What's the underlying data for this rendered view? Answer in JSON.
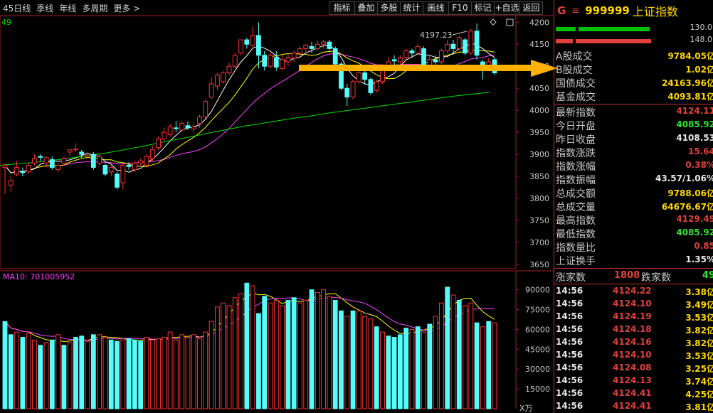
{
  "toolbar": {
    "left": [
      "45日线",
      "季线",
      "年线",
      "多周期",
      "更多 >"
    ],
    "right": [
      "指标",
      "叠加",
      "多股",
      "统计",
      "画线",
      "F10",
      "标记",
      "+自选",
      "返回"
    ]
  },
  "chart": {
    "ma_indicator_label": "49",
    "peak_label": "4197.23",
    "price_ticks": [
      "4200",
      "4150",
      "4100",
      "4050",
      "4000",
      "3950",
      "3900",
      "3850",
      "3800",
      "3750",
      "3700",
      "3650"
    ],
    "volume_indicator_label": "MA10: 701005952",
    "volume_ticks": [
      "90000",
      "75000",
      "60000",
      "45000",
      "30000",
      "15000"
    ],
    "volume_unit": "X万",
    "colors": {
      "up": "#ff3232",
      "down": "#54fcfc",
      "ma5": "#ffffff",
      "ma10": "#ffff00",
      "ma20": "#ff40ff",
      "ma60": "#00e000"
    }
  },
  "chart_data": {
    "type": "candlestick",
    "ylim": [
      3640,
      4215
    ],
    "candles": [
      [
        3870,
        3875,
        3810,
        3880
      ],
      [
        3830,
        3840,
        3815,
        3850
      ],
      [
        3855,
        3870,
        3850,
        3885
      ],
      [
        3860,
        3858,
        3850,
        3870
      ],
      [
        3860,
        3875,
        3855,
        3880
      ],
      [
        3880,
        3890,
        3875,
        3900
      ],
      [
        3895,
        3893,
        3885,
        3900
      ],
      [
        3880,
        3892,
        3870,
        3895
      ],
      [
        3888,
        3870,
        3865,
        3895
      ],
      [
        3865,
        3875,
        3860,
        3880
      ],
      [
        3880,
        3890,
        3875,
        3895
      ],
      [
        3905,
        3910,
        3895,
        3912
      ],
      [
        3910,
        3912,
        3905,
        3925
      ],
      [
        3905,
        3900,
        3890,
        3910
      ],
      [
        3895,
        3898,
        3890,
        3905
      ],
      [
        3900,
        3870,
        3865,
        3905
      ],
      [
        3880,
        3895,
        3875,
        3900
      ],
      [
        3875,
        3855,
        3850,
        3880
      ],
      [
        3860,
        3870,
        3850,
        3875
      ],
      [
        3855,
        3825,
        3820,
        3860
      ],
      [
        3835,
        3875,
        3820,
        3880
      ],
      [
        3875,
        3872,
        3865,
        3882
      ],
      [
        3865,
        3880,
        3860,
        3885
      ],
      [
        3880,
        3885,
        3875,
        3890
      ],
      [
        3875,
        3895,
        3870,
        3900
      ],
      [
        3890,
        3910,
        3885,
        3920
      ],
      [
        3915,
        3935,
        3910,
        3940
      ],
      [
        3935,
        3950,
        3930,
        3960
      ],
      [
        3945,
        3962,
        3940,
        3970
      ],
      [
        3960,
        3958,
        3950,
        3975
      ],
      [
        3955,
        3970,
        3950,
        3975
      ],
      [
        3965,
        3960,
        3955,
        3975
      ],
      [
        3958,
        3962,
        3950,
        3970
      ],
      [
        3970,
        3985,
        3960,
        3990
      ],
      [
        3985,
        4020,
        3980,
        4025
      ],
      [
        4030,
        4060,
        4025,
        4075
      ],
      [
        4055,
        4080,
        4045,
        4085
      ],
      [
        4065,
        4085,
        4060,
        4090
      ],
      [
        4085,
        4100,
        4080,
        4108
      ],
      [
        4100,
        4125,
        4095,
        4130
      ],
      [
        4130,
        4160,
        4125,
        4160
      ],
      [
        4160,
        4150,
        4140,
        4165
      ],
      [
        4148,
        4170,
        4140,
        4190
      ],
      [
        4170,
        4125,
        4095,
        4200
      ],
      [
        4125,
        4100,
        4090,
        4135
      ],
      [
        4100,
        4125,
        4095,
        4130
      ],
      [
        4120,
        4098,
        4090,
        4135
      ],
      [
        4095,
        4115,
        4090,
        4125
      ],
      [
        4110,
        4120,
        4100,
        4128
      ],
      [
        4118,
        4130,
        4110,
        4135
      ],
      [
        4130,
        4140,
        4120,
        4145
      ],
      [
        4140,
        4148,
        4130,
        4150
      ],
      [
        4145,
        4140,
        4130,
        4155
      ],
      [
        4140,
        4150,
        4135,
        4158
      ],
      [
        4150,
        4155,
        4140,
        4160
      ],
      [
        4155,
        4140,
        4135,
        4160
      ],
      [
        4140,
        4105,
        4100,
        4145
      ],
      [
        4105,
        4050,
        4045,
        4110
      ],
      [
        4050,
        4030,
        4010,
        4060
      ],
      [
        4030,
        4065,
        4025,
        4070
      ],
      [
        4065,
        4085,
        4060,
        4090
      ],
      [
        4085,
        4070,
        4060,
        4090
      ],
      [
        4070,
        4040,
        4035,
        4075
      ],
      [
        4045,
        4065,
        4040,
        4070
      ],
      [
        4065,
        4095,
        4060,
        4100
      ],
      [
        4100,
        4110,
        4095,
        4120
      ],
      [
        4115,
        4112,
        4100,
        4125
      ],
      [
        4110,
        4120,
        4100,
        4125
      ],
      [
        4120,
        4135,
        4115,
        4140
      ],
      [
        4135,
        4130,
        4120,
        4140
      ],
      [
        4130,
        4145,
        4125,
        4150
      ],
      [
        4140,
        4100,
        4095,
        4145
      ],
      [
        4100,
        4115,
        4095,
        4125
      ],
      [
        4115,
        4110,
        4100,
        4125
      ],
      [
        4110,
        4135,
        4105,
        4140
      ],
      [
        4135,
        4150,
        4130,
        4160
      ],
      [
        4150,
        4140,
        4130,
        4160
      ],
      [
        4140,
        4165,
        4135,
        4170
      ],
      [
        4160,
        4130,
        4125,
        4165
      ],
      [
        4130,
        4180,
        4125,
        4185
      ],
      [
        4180,
        4125,
        4115,
        4197
      ],
      [
        4110,
        4100,
        4070,
        4115
      ],
      [
        4100,
        4110,
        4095,
        4118
      ],
      [
        4115,
        4085,
        4080,
        4120
      ]
    ],
    "volumes": [
      [
        66,
        1
      ],
      [
        56,
        1
      ],
      [
        58,
        0
      ],
      [
        54,
        1
      ],
      [
        57,
        0
      ],
      [
        52,
        0
      ],
      [
        48,
        1
      ],
      [
        50,
        0
      ],
      [
        52,
        1
      ],
      [
        56,
        0
      ],
      [
        48,
        1
      ],
      [
        50,
        0
      ],
      [
        54,
        1
      ],
      [
        55,
        1
      ],
      [
        51,
        0
      ],
      [
        56,
        1
      ],
      [
        56,
        0
      ],
      [
        54,
        0
      ],
      [
        52,
        1
      ],
      [
        51,
        1
      ],
      [
        52,
        0
      ],
      [
        53,
        1
      ],
      [
        52,
        1
      ],
      [
        51,
        1
      ],
      [
        54,
        0
      ],
      [
        52,
        0
      ],
      [
        53,
        0
      ],
      [
        54,
        0
      ],
      [
        58,
        0
      ],
      [
        52,
        0
      ],
      [
        56,
        0
      ],
      [
        54,
        0
      ],
      [
        56,
        0
      ],
      [
        53,
        0
      ],
      [
        58,
        0
      ],
      [
        66,
        0
      ],
      [
        77,
        0
      ],
      [
        80,
        0
      ],
      [
        78,
        0
      ],
      [
        84,
        0
      ],
      [
        87,
        0
      ],
      [
        95,
        1
      ],
      [
        93,
        0
      ],
      [
        72,
        1
      ],
      [
        85,
        1
      ],
      [
        80,
        0
      ],
      [
        82,
        0
      ],
      [
        78,
        0
      ],
      [
        82,
        1
      ],
      [
        84,
        1
      ],
      [
        80,
        0
      ],
      [
        82,
        0
      ],
      [
        90,
        1
      ],
      [
        88,
        0
      ],
      [
        90,
        0
      ],
      [
        85,
        0
      ],
      [
        82,
        1
      ],
      [
        74,
        1
      ],
      [
        70,
        0
      ],
      [
        74,
        1
      ],
      [
        74,
        0
      ],
      [
        70,
        0
      ],
      [
        68,
        0
      ],
      [
        62,
        1
      ],
      [
        58,
        0
      ],
      [
        55,
        1
      ],
      [
        54,
        1
      ],
      [
        56,
        1
      ],
      [
        61,
        1
      ],
      [
        60,
        0
      ],
      [
        62,
        1
      ],
      [
        58,
        0
      ],
      [
        64,
        1
      ],
      [
        70,
        0
      ],
      [
        80,
        0
      ],
      [
        92,
        1
      ],
      [
        86,
        0
      ],
      [
        82,
        1
      ],
      [
        78,
        0
      ],
      [
        80,
        0
      ],
      [
        65,
        1
      ],
      [
        62,
        0
      ],
      [
        66,
        1
      ],
      [
        65,
        0
      ]
    ],
    "ma60_levels": [
      3875,
      3878,
      3881,
      3885,
      3890,
      3895,
      3900,
      3906,
      3913,
      3920,
      3928,
      3935,
      3942,
      3950,
      3957,
      3964,
      3970,
      3976,
      3982,
      3987,
      3993,
      3998,
      4003,
      4008,
      4013,
      4018,
      4023,
      4028,
      4033,
      4037,
      4041
    ]
  },
  "info": {
    "top_icon": "G",
    "menu_icon": "≡",
    "code": "999999",
    "name": "上证指数",
    "bars": [
      {
        "value": "130.0",
        "segments": [
          {
            "w": 28,
            "color": "#00c000"
          },
          {
            "w": 100,
            "color": "#00c000"
          }
        ]
      },
      {
        "value": "148.0",
        "segments": [
          {
            "w": 24,
            "color": "#e0403a"
          },
          {
            "w": 106,
            "color": "#e0403a"
          }
        ]
      }
    ],
    "stats": [
      {
        "label": "A股成交",
        "value": "9784.05亿",
        "color": "#ffd700"
      },
      {
        "label": "B股成交",
        "value": "1.02亿",
        "color": "#ffd700"
      },
      {
        "label": "国债成交",
        "value": "24163.96亿",
        "color": "#ffd700"
      },
      {
        "label": "基金成交",
        "value": "4093.81亿",
        "color": "#ffd700"
      }
    ],
    "quote": [
      {
        "label": "最新指数",
        "value": "4124.11",
        "color": "#e0403a"
      },
      {
        "label": "今日开盘",
        "value": "4085.92",
        "color": "#30e030"
      },
      {
        "label": "昨日收盘",
        "value": "4108.53",
        "color": "#e8e8e8"
      },
      {
        "label": "指数涨跌",
        "value": "15.64",
        "color": "#e0403a"
      },
      {
        "label": "指数涨幅",
        "value": "0.38%",
        "color": "#e0403a"
      },
      {
        "label": "指数振幅",
        "value": "43.57/1.06%",
        "color": "#e8e8e8"
      },
      {
        "label": "总成交额",
        "value": "9788.06亿",
        "color": "#ffd700"
      },
      {
        "label": "总成交量",
        "value": "64676.67亿",
        "color": "#ffd700"
      },
      {
        "label": "最高指数",
        "value": "4129.49",
        "color": "#e0403a"
      },
      {
        "label": "最低指数",
        "value": "4085.92",
        "color": "#30e030"
      },
      {
        "label": "指数量比",
        "value": "0.85",
        "color": "#e0403a"
      },
      {
        "label": "上证换手",
        "value": "1.35%",
        "color": "#e8e8e8"
      }
    ],
    "advance_label": "涨家数",
    "advance_value": "1808",
    "decline_label": "跌家数",
    "decline_value": "49",
    "ticks": [
      {
        "time": "14:56",
        "price": "4124.22",
        "vol": "3.38亿"
      },
      {
        "time": "14:56",
        "price": "4124.10",
        "vol": "3.49亿"
      },
      {
        "time": "14:56",
        "price": "4124.19",
        "vol": "3.53亿"
      },
      {
        "time": "14:56",
        "price": "4124.18",
        "vol": "3.82亿"
      },
      {
        "time": "14:56",
        "price": "4124.16",
        "vol": "3.82亿"
      },
      {
        "time": "14:56",
        "price": "4124.10",
        "vol": "3.53亿"
      },
      {
        "time": "14:56",
        "price": "4124.08",
        "vol": "3.25亿"
      },
      {
        "time": "14:56",
        "price": "4124.13",
        "vol": "3.74亿"
      },
      {
        "time": "14:56",
        "price": "4124.41",
        "vol": "4.25亿"
      },
      {
        "time": "14:56",
        "price": "4124.41",
        "vol": "3.81亿"
      }
    ]
  }
}
